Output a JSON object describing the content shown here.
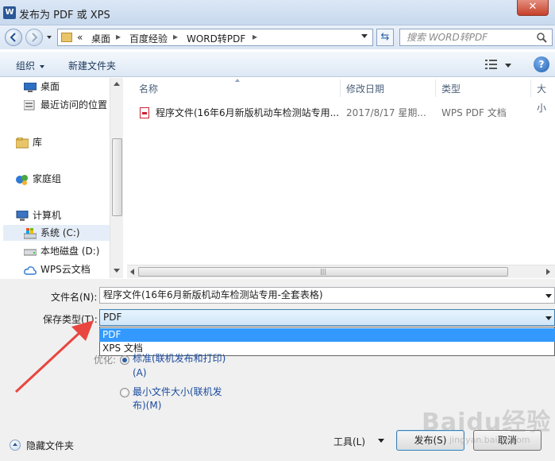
{
  "window": {
    "title": "发布为 PDF 或 XPS",
    "app_icon": "W",
    "close": "✕"
  },
  "address": {
    "overflow": "«",
    "crumbs": [
      "桌面",
      "百度经验",
      "WORD转PDF"
    ],
    "search_placeholder": "搜索 WORD转PDF"
  },
  "toolbar": {
    "organize": "组织",
    "new_folder": "新建文件夹"
  },
  "nav": {
    "items": [
      {
        "label": "桌面",
        "icon": "desktop-icon"
      },
      {
        "label": "最近访问的位置",
        "icon": "recent-places-icon"
      },
      {
        "label": "库",
        "icon": "library-icon"
      },
      {
        "label": "家庭组",
        "icon": "homegroup-icon"
      },
      {
        "label": "计算机",
        "icon": "computer-icon"
      },
      {
        "label": "系统 (C:)",
        "icon": "drive-c-icon"
      },
      {
        "label": "本地磁盘 (D:)",
        "icon": "drive-d-icon"
      },
      {
        "label": "WPS云文档",
        "icon": "cloud-icon"
      }
    ]
  },
  "columns": {
    "name": "名称",
    "modified": "修改日期",
    "type": "类型",
    "size": "大小"
  },
  "files": [
    {
      "name": "程序文件(16年6月新版机动车检测站专用...",
      "modified": "2017/8/17 星期...",
      "type": "WPS PDF 文档"
    }
  ],
  "form": {
    "filename_label": "文件名(N):",
    "filename_value": "程序文件(16年6月新版机动车检测站专用-全套表格)",
    "savetype_label": "保存类型(T):",
    "savetype_value": "PDF",
    "options": [
      "PDF",
      "XPS 文档"
    ],
    "optimize_label": "优化:",
    "radio1_line1": "标准(联机发布和打印)",
    "radio1_line2": "(A)",
    "radio2_line1": "最小文件大小(联机发",
    "radio2_line2": "布)(M)",
    "hide_folders": "隐藏文件夹",
    "tools": "工具(L)",
    "publish": "发布(S)",
    "cancel": "取消"
  },
  "watermark": {
    "main": "Baidu经验",
    "sub": "jingyan.baidu.com"
  },
  "colors": {
    "selection": "#3399ff",
    "arrow": "#e8463f",
    "accent": "#1a4a9e"
  }
}
